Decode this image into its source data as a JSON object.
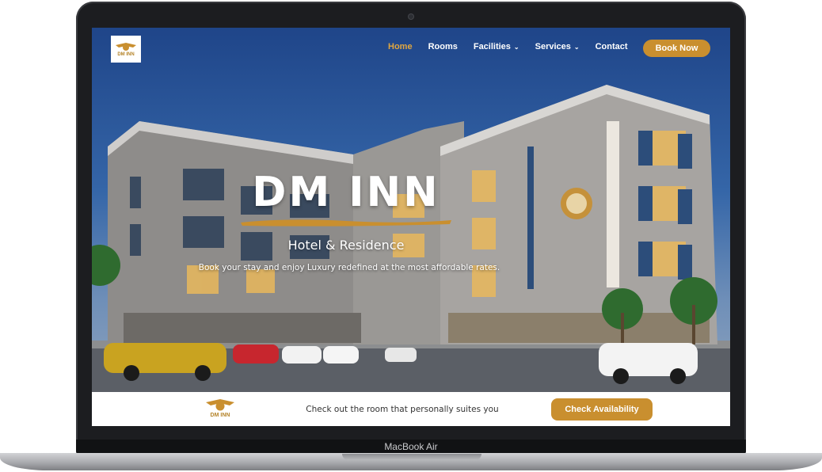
{
  "device": {
    "label": "MacBook Air"
  },
  "nav": {
    "logo_text": "DM INN",
    "items": [
      {
        "label": "Home",
        "active": true,
        "has_dropdown": false
      },
      {
        "label": "Rooms",
        "active": false,
        "has_dropdown": false
      },
      {
        "label": "Facilities",
        "active": false,
        "has_dropdown": true
      },
      {
        "label": "Services",
        "active": false,
        "has_dropdown": true
      },
      {
        "label": "Contact",
        "active": false,
        "has_dropdown": false
      }
    ],
    "book_label": "Book Now",
    "dropdown_icon": "chevron-down-icon"
  },
  "hero": {
    "title": "DM INN",
    "subtitle": "Hotel & Residence",
    "tagline": "Book your stay and enjoy Luxury redefined at the most affordable rates."
  },
  "bottom_bar": {
    "logo_text": "DM INN",
    "cta_text": "Check out the room that personally suites you",
    "button_label": "Check Availability"
  },
  "colors": {
    "accent": "#c98f2f",
    "nav_active": "#e0a640",
    "sky": "#2a55a0"
  }
}
